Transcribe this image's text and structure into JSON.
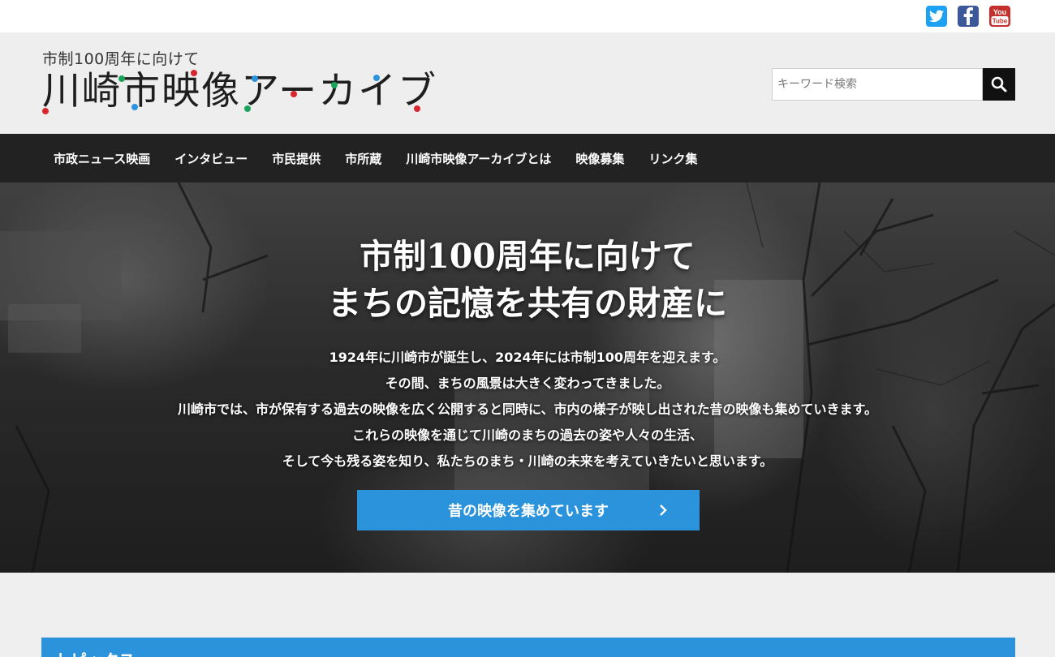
{
  "social": {
    "twitter_icon": "twitter-icon",
    "facebook_icon": "facebook-icon",
    "youtube_icon": "youtube-icon",
    "youtube_text_1": "You",
    "youtube_text_2": "Tube",
    "colors": {
      "twitter": "#1da1f2",
      "facebook": "#3b5998",
      "youtube": "#c4302b"
    }
  },
  "header": {
    "logo_subtitle": "市制100周年に向けて",
    "logo_title": "川崎市映像アーカイブ",
    "search_placeholder": "キーワード検索",
    "search_icon": "search-icon"
  },
  "nav": {
    "items": [
      {
        "label": "市政ニュース映画"
      },
      {
        "label": "インタビュー"
      },
      {
        "label": "市民提供"
      },
      {
        "label": "市所蔵"
      },
      {
        "label": "川崎市映像アーカイブとは"
      },
      {
        "label": "映像募集"
      },
      {
        "label": "リンク集"
      }
    ]
  },
  "hero": {
    "heading_line1": "市制100周年に向けて",
    "heading_line2": "まちの記憶を共有の財産に",
    "lead_lines": [
      "1924年に川崎市が誕生し、2024年には市制100周年を迎えます。",
      "その間、まちの風景は大きく変わってきました。",
      "川崎市では、市が保有する過去の映像を広く公開すると同時に、市内の様子が映し出された昔の映像も集めていきます。",
      "これらの映像を通じて川崎のまちの過去の姿や人々の生活、",
      "そして今も残る姿を知り、私たちのまち・川崎の未来を考えていきたいと思います。"
    ],
    "cta_label": "昔の映像を集めています",
    "cta_icon": "chevron-right-icon"
  },
  "topics": {
    "title": "トピックス"
  },
  "colors": {
    "accent": "#2a93db",
    "nav_bg": "#222222",
    "header_bg": "#eeeeee"
  }
}
